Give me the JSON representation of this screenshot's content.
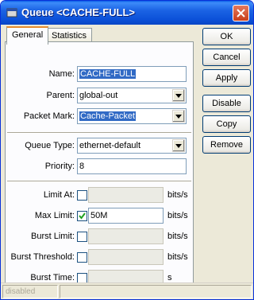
{
  "window": {
    "title": "Queue <CACHE-FULL>",
    "colors": {
      "titlebar": "#0b50d8",
      "face": "#ece9d8",
      "selection": "#316ac5",
      "tab_highlight": "#e68b2c"
    }
  },
  "tabs": [
    {
      "label": "General",
      "active": true
    },
    {
      "label": "Statistics",
      "active": false
    }
  ],
  "general": {
    "name": {
      "label": "Name:",
      "value": "CACHE-FULL"
    },
    "parent": {
      "label": "Parent:",
      "value": "global-out"
    },
    "packet_mark": {
      "label": "Packet Mark:",
      "value": "Cache-Packet"
    },
    "queue_type": {
      "label": "Queue Type:",
      "value": "ethernet-default"
    },
    "priority": {
      "label": "Priority:",
      "value": "8"
    },
    "limit_at": {
      "label": "Limit At:",
      "checked": false,
      "value": "",
      "unit": "bits/s"
    },
    "max_limit": {
      "label": "Max Limit:",
      "checked": true,
      "value": "50M",
      "unit": "bits/s"
    },
    "burst_limit": {
      "label": "Burst Limit:",
      "checked": false,
      "value": "",
      "unit": "bits/s"
    },
    "burst_threshold": {
      "label": "Burst Threshold:",
      "checked": false,
      "value": "",
      "unit": "bits/s"
    },
    "burst_time": {
      "label": "Burst Time:",
      "checked": false,
      "value": "",
      "unit": "s"
    }
  },
  "buttons": {
    "ok": "OK",
    "cancel": "Cancel",
    "apply": "Apply",
    "disable": "Disable",
    "copy": "Copy",
    "remove": "Remove"
  },
  "status": {
    "text": "disabled"
  }
}
